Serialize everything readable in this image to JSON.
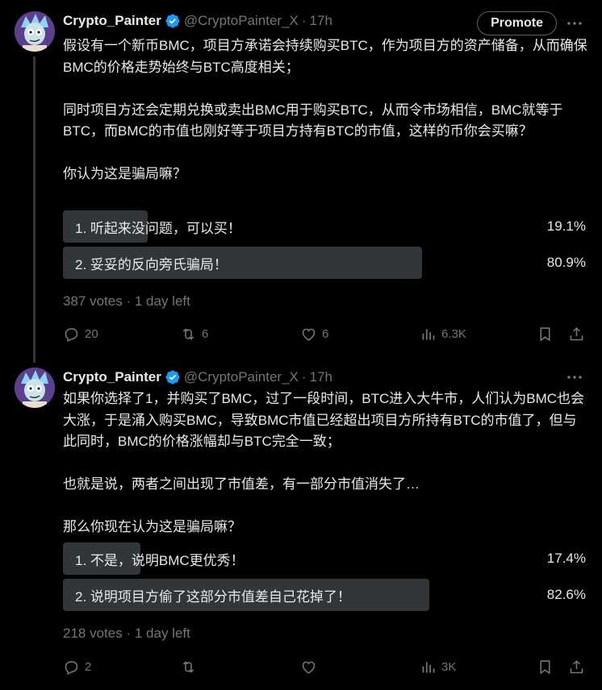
{
  "tweets": [
    {
      "name": "Crypto_Painter",
      "handle": "@CryptoPainter_X",
      "time_sep": "·",
      "time": "17h",
      "promote": "Promote",
      "paragraphs": [
        "假设有一个新币BMC，项目方承诺会持续购买BTC，作为项目方的资产储备，从而确保BMC的价格走势始终与BTC高度相关；",
        "",
        "同时项目方还会定期兑换或卖出BMC用于购买BTC，从而令市场相信，BMC就等于BTC，而BMC的市值也刚好等于项目方持有BTC的市值，这样的币你会买嘛？",
        "",
        "你认为这是骗局嘛？"
      ],
      "poll": [
        {
          "label": "1. 听起来没问题，可以买！",
          "percent": "19.1%",
          "fraction": 0.191
        },
        {
          "label": "2. 妥妥的反向旁氏骗局！",
          "percent": "80.9%",
          "fraction": 0.809
        }
      ],
      "votes": "387 votes",
      "time_left": "· 1 day left",
      "replies": "20",
      "reposts": "6",
      "likes": "6",
      "views": "6.3K"
    },
    {
      "name": "Crypto_Painter",
      "handle": "@CryptoPainter_X",
      "time_sep": "·",
      "time": "17h",
      "paragraphs": [
        "如果你选择了1，并购买了BMC，过了一段时间，BTC进入大牛市，人们认为BMC也会大涨，于是涌入购买BMC，导致BMC市值已经超出项目方所持有BTC的市值了，但与此同时，BMC的价格涨幅却与BTC完全一致；",
        "",
        "也就是说，两者之间出现了市值差，有一部分市值消失了…",
        "",
        "那么你现在认为这是骗局嘛？"
      ],
      "poll": [
        {
          "label": "1. 不是，说明BMC更优秀！",
          "percent": "17.4%",
          "fraction": 0.174
        },
        {
          "label": "2. 说明项目方偷了这部分市值差自己花掉了！",
          "percent": "82.6%",
          "fraction": 0.826
        }
      ],
      "votes": "218 votes",
      "time_left": "· 1 day left",
      "replies": "2",
      "reposts": "",
      "likes": "",
      "views": "3K"
    }
  ],
  "colors": {
    "background": "#000000",
    "text": "#e7e9ea",
    "muted": "#71767b",
    "poll_bar": "#333639",
    "verified": "#1d9bf0"
  },
  "icons": [
    "verified-badge-icon",
    "more-icon",
    "reply-icon",
    "repost-icon",
    "like-icon",
    "views-icon",
    "bookmark-icon",
    "share-icon"
  ]
}
